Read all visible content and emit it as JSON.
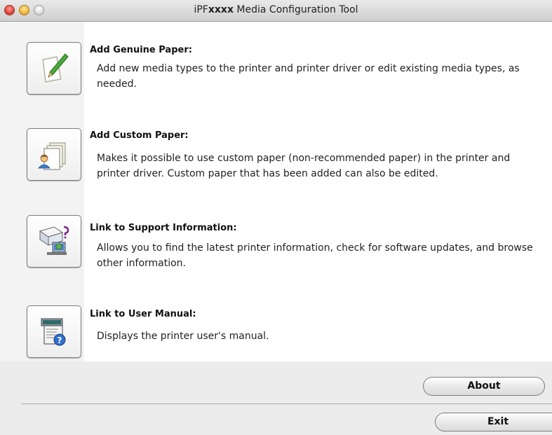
{
  "window": {
    "title_prefix": "iPF",
    "title_model": "xxxx",
    "title_suffix": " Media Configuration Tool"
  },
  "items": [
    {
      "title": "Add Genuine Paper:",
      "description": "Add new media types to the printer and printer driver or edit existing media types, as needed.",
      "icon": "paper-pencil-icon"
    },
    {
      "title": "Add Custom Paper:",
      "description": "Makes it possible to use custom paper (non-recommended paper) in the printer and printer driver. Custom paper that has been added can also be edited.",
      "icon": "custom-paper-user-icon"
    },
    {
      "title": "Link to Support Information:",
      "description": "Allows you to find the latest printer information, check for software updates, and browse other information.",
      "icon": "support-info-icon"
    },
    {
      "title": "Link to User Manual:",
      "description": "Displays the printer user's manual.",
      "icon": "user-manual-icon"
    }
  ],
  "buttons": {
    "about": "About",
    "exit": "Exit"
  }
}
